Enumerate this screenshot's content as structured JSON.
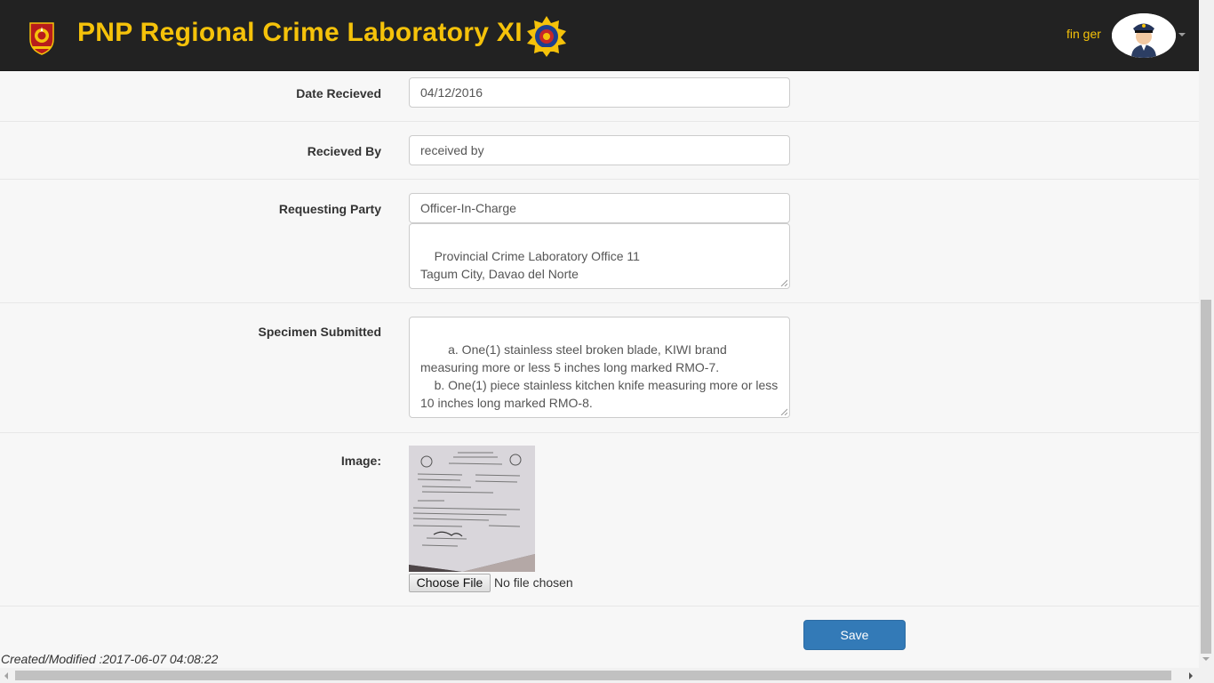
{
  "header": {
    "title": "PNP Regional Crime Laboratory XI",
    "user_name": "fin ger",
    "left_logo_icon": "pnp-seal-icon",
    "right_logo_icon": "forensic-badge-icon",
    "avatar_icon": "police-officer-avatar-icon"
  },
  "form": {
    "date_received": {
      "label": "Date Recieved",
      "value": "04/12/2016"
    },
    "received_by": {
      "label": "Recieved By",
      "value": "received by"
    },
    "requesting_party": {
      "label": "Requesting Party",
      "value": "Officer-In-Charge",
      "address": "Provincial Crime Laboratory Office 11\nTagum City, Davao del Norte"
    },
    "specimen_submitted": {
      "label": "Specimen Submitted",
      "value": "    a. One(1) stainless steel broken blade, KIWI brand measuring more or less 5 inches long marked RMO-7.\n    b. One(1) piece stainless kitchen knife measuring more or less 10 inches long marked RMO-8."
    },
    "image": {
      "label": "Image:",
      "choose_file_label": "Choose File",
      "file_status": "No file chosen"
    },
    "save_label": "Save"
  },
  "footer": {
    "created_modified": "Created/Modified :2017-06-07 04:08:22"
  },
  "colors": {
    "navbar_bg": "#222222",
    "brand_yellow": "#f5c20a",
    "primary_button": "#337ab7"
  }
}
